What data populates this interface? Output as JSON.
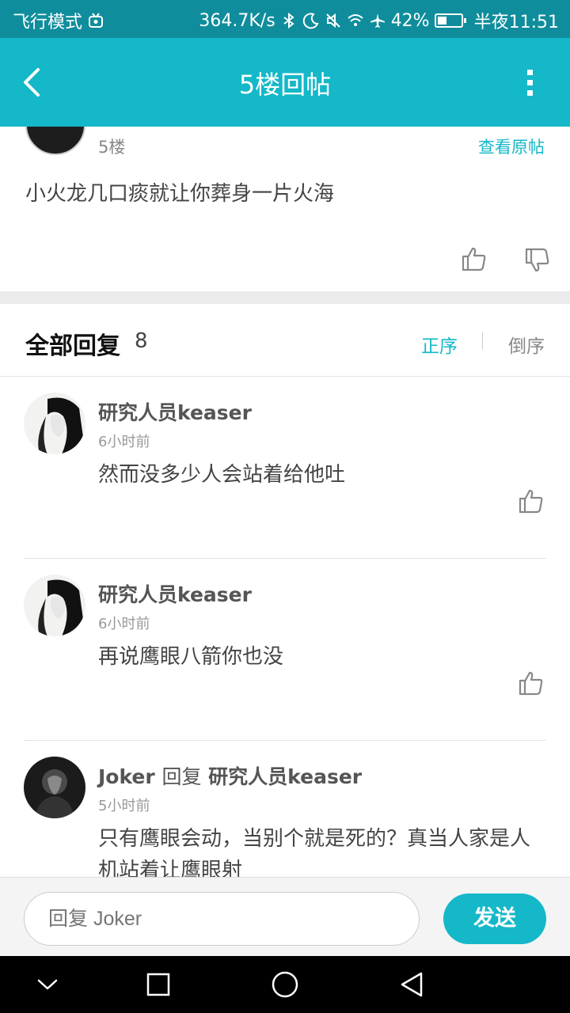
{
  "status_bar": {
    "left_text": "飞行模式",
    "speed": "364.7K/s",
    "battery_percent": "42%",
    "battery_level": 0.42,
    "time": "半夜11:51"
  },
  "toolbar": {
    "title": "5楼回帖"
  },
  "post": {
    "floor": "5楼",
    "view_original": "查看原帖",
    "content": "小火龙几口痰就让你葬身一片火海"
  },
  "replies_header": {
    "title": "全部回复",
    "count": "8",
    "sort_asc": "正序",
    "sort_desc": "倒序"
  },
  "replies": [
    {
      "author": "研究人员keaser",
      "time": "6小时前",
      "text": "然而没多少人会站着给他吐"
    },
    {
      "author": "研究人员keaser",
      "time": "6小时前",
      "text": "再说鹰眼八箭你也没"
    },
    {
      "author": "Joker",
      "reply_word": "回复",
      "reply_to": "研究人员keaser",
      "time": "5小时前",
      "text": "只有鹰眼会动，当别个就是死的？真当人家是人机站着让鹰眼射"
    }
  ],
  "input_bar": {
    "placeholder": "回复 Joker",
    "send_label": "发送"
  },
  "colors": {
    "accent": "#14b8c8",
    "status_bar": "#0f8d9c"
  }
}
